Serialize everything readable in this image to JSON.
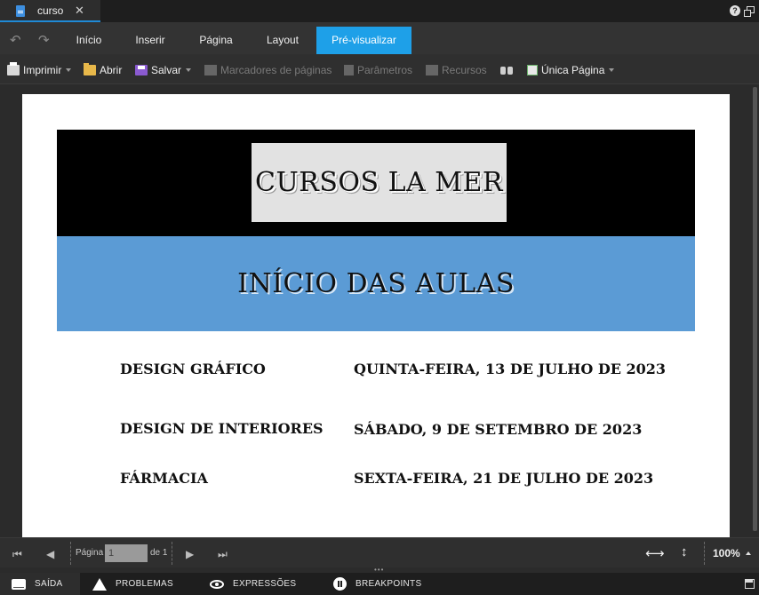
{
  "tab": {
    "title": "curso",
    "close": "✕"
  },
  "ribbon": {
    "undo": "↶",
    "redo": "↷",
    "tabs": [
      "Início",
      "Inserir",
      "Página",
      "Layout",
      "Pré-visualizar"
    ]
  },
  "toolbar": {
    "print": "Imprimir",
    "open": "Abrir",
    "save": "Salvar",
    "bookmarks": "Marcadores de páginas",
    "parameters": "Parâmetros",
    "resources": "Recursos",
    "single_page": "Única Página"
  },
  "report": {
    "title": "CURSOS LA MER",
    "subtitle": "INÍCIO DAS AULAS",
    "courses": [
      {
        "name": "DESIGN GRÁFICO",
        "date": "QUINTA-FEIRA, 13 DE JULHO DE 2023"
      },
      {
        "name": "DESIGN DE INTERIORES",
        "date": "SÁBADO, 9 DE SETEMBRO DE 2023"
      },
      {
        "name": "FÁRMACIA",
        "date": "SEXTA-FEIRA, 21 DE JULHO DE 2023"
      }
    ]
  },
  "navigation": {
    "page_label": "Página",
    "page_value": "1",
    "of_label": "de 1",
    "zoom": "100%"
  },
  "status_tabs": [
    "SAÍDA",
    "PROBLEMAS",
    "EXPRESSÕES",
    "BREAKPOINTS"
  ],
  "icons": {
    "first": "⏮",
    "prev": "◀",
    "next": "▶",
    "last": "⏭",
    "fit_width": "⟷",
    "fit_height": "↕",
    "help": "?"
  },
  "colors": {
    "accent": "#1ea0e8",
    "header_band": "#000000",
    "subtitle_band": "#5b9bd5",
    "title_box": "#e2e2e2"
  }
}
